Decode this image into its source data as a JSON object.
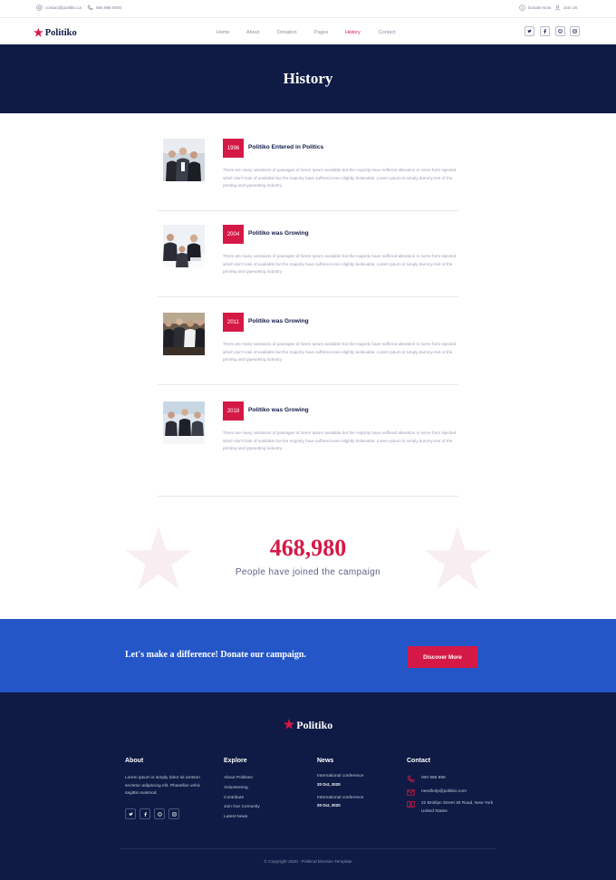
{
  "topbar": {
    "email": "contact@politiko.ca",
    "phone": "666 888 0000",
    "donate_label": "Donate Now",
    "join_label": "Join Us"
  },
  "nav": {
    "logo": "Politiko",
    "links": [
      "Home",
      "About",
      "Donation",
      "Pages",
      "History",
      "Contact"
    ],
    "active": "History",
    "social_icons": [
      "twitter-icon",
      "facebook-icon",
      "dribbble-icon",
      "instagram-icon"
    ]
  },
  "page": {
    "title": "History"
  },
  "timeline": [
    {
      "year": "1996",
      "title": "Politiko Entered in Politics",
      "text": "There are many variations of passages of lorem Ipsum available but the majority have suffered alteration in some form injected which don't look of available but the majority have suffered even slightly believable. Lorem Ipsum is simply dummy text of the printing and typesetting industry."
    },
    {
      "year": "2004",
      "title": "Politiko was Growing",
      "text": "There are many variations of passages of lorem Ipsum available but the majority have suffered alteration in some form injected which don't look of available but the majority have suffered even slightly believable. Lorem Ipsum is simply dummy text of the printing and typesetting industry."
    },
    {
      "year": "2011",
      "title": "Politiko was Growing",
      "text": "There are many variations of passages of lorem Ipsum available but the majority have suffered alteration in some form injected which don't look of available but the majority have suffered even slightly believable. Lorem Ipsum is simply dummy text of the printing and typesetting industry."
    },
    {
      "year": "2018",
      "title": "Politiko was Growing",
      "text": "There are many variations of passages of lorem Ipsum available but the majority have suffered alteration in some form injected which don't look of available but the majority have suffered even slightly believable. Lorem Ipsum is simply dummy text of the printing and typesetting industry."
    }
  ],
  "counter": {
    "number": "468,980",
    "label": "People have joined the campaign"
  },
  "donate": {
    "text": "Let's make a difference! Donate our campaign.",
    "button": "Discover More"
  },
  "footer": {
    "logo": "Politiko",
    "about": {
      "title": "About",
      "text": "Lorem ipsum is simply dolor sit ameton sectetur adipiscing elit. Phasellus vehic sagittis euismod."
    },
    "explore": {
      "title": "Explore",
      "links": [
        "About Politisen",
        "Volunteering",
        "Contribute",
        "Join Our Comunity",
        "Latest News"
      ]
    },
    "news": {
      "title": "News",
      "items": [
        {
          "title": "International conference",
          "date": "20 Oct, 2020"
        },
        {
          "title": "International conference",
          "date": "20 Oct, 2020"
        }
      ]
    },
    "contact": {
      "title": "Contact",
      "phone": "000 666 999",
      "email": "needhelp@politiko.com",
      "address": "22 Broklyn Street 30 Road, New York United States"
    },
    "copyright": "© Copyright 2020 - Political Election Template"
  },
  "colors": {
    "navy": "#0f1b45",
    "accent": "#d51946",
    "blue_band": "#2456c8"
  }
}
